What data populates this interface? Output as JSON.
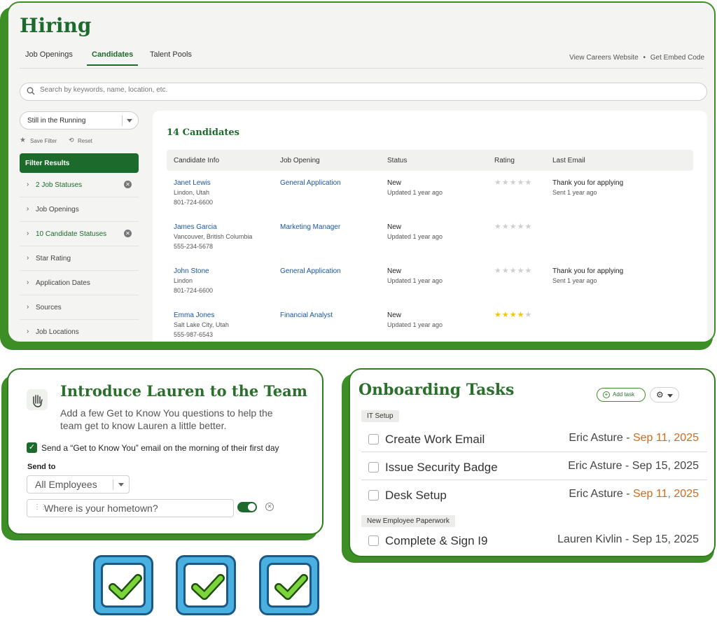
{
  "hiring": {
    "title": "Hiring",
    "tabs": [
      {
        "label": "Job Openings"
      },
      {
        "label": "Candidates"
      },
      {
        "label": "Talent Pools"
      }
    ],
    "links": {
      "view": "View Careers Website",
      "embed": "Get Embed Code"
    },
    "search_placeholder": "Search by keywords, name, location, etc.",
    "filter_dropdown": "Still in the Running",
    "save_filter": "Save Filter",
    "reset": "Reset",
    "filter_results": "Filter Results",
    "filters": [
      {
        "label": "2 Job Statuses",
        "active": true
      },
      {
        "label": "Job Openings",
        "active": false
      },
      {
        "label": "10 Candidate Statuses",
        "active": true
      },
      {
        "label": "Star Rating",
        "active": false
      },
      {
        "label": "Application Dates",
        "active": false
      },
      {
        "label": "Sources",
        "active": false
      },
      {
        "label": "Job Locations",
        "active": false
      }
    ],
    "count": "14 Candidates",
    "columns": [
      "Candidate Info",
      "Job Opening",
      "Status",
      "Rating",
      "Last Email"
    ],
    "rows": [
      {
        "name": "Janet Lewis",
        "location": "Lindon, Utah",
        "phone": "801-724-6600",
        "job": "General Application",
        "status": "New",
        "updated": "Updated 1 year ago",
        "rating": 0,
        "email": "Thank you for applying",
        "sent": "Sent 1 year ago"
      },
      {
        "name": "James Garcia",
        "location": "Vancouver, British Columbia",
        "phone": "555-234-5678",
        "job": "Marketing Manager",
        "status": "New",
        "updated": "Updated 1 year ago",
        "rating": 0,
        "email": "",
        "sent": ""
      },
      {
        "name": "John Stone",
        "location": "Lindon",
        "phone": "801-724-6600",
        "job": "General Application",
        "status": "New",
        "updated": "Updated 1 year ago",
        "rating": 0,
        "email": "Thank you for applying",
        "sent": "Sent 1 year ago"
      },
      {
        "name": "Emma Jones",
        "location": "Salt Lake City, Utah",
        "phone": "555-987-6543",
        "job": "Financial Analyst",
        "status": "New",
        "updated": "Updated 1 year ago",
        "rating": 4,
        "email": "",
        "sent": ""
      }
    ]
  },
  "intro": {
    "title": "Introduce Lauren to the Team",
    "description": "Add a few Get to Know You questions to help the team get to know Lauren a little better.",
    "send_email": "Send a “Get to Know You” email on the morning of their first day",
    "send_to_label": "Send to",
    "send_to_value": "All Employees",
    "question": "Where is your hometown?"
  },
  "onboarding": {
    "title": "Onboarding Tasks",
    "add_task": "Add task",
    "sections": [
      {
        "label": "IT Setup",
        "tasks": [
          {
            "name": "Create Work Email",
            "assignee": "Eric Asture",
            "date": "Sep 11, 2025",
            "overdue": true
          },
          {
            "name": "Issue Security Badge",
            "assignee": "Eric Asture",
            "date": "Sep 15, 2025",
            "overdue": false
          },
          {
            "name": "Desk Setup",
            "assignee": "Eric Asture",
            "date": "Sep 11, 2025",
            "overdue": true
          }
        ]
      },
      {
        "label": "New Employee Paperwork",
        "tasks": [
          {
            "name": "Complete & Sign I9",
            "assignee": "Lauren Kivlin",
            "date": "Sep 15, 2025",
            "overdue": false
          }
        ]
      }
    ]
  },
  "colors": {
    "brand_green": "#1d6b2c",
    "overdue": "#d2691e",
    "link_blue": "#1b56a0",
    "tile_blue": "#4ab0e0",
    "check_green": "#7bd43a"
  }
}
